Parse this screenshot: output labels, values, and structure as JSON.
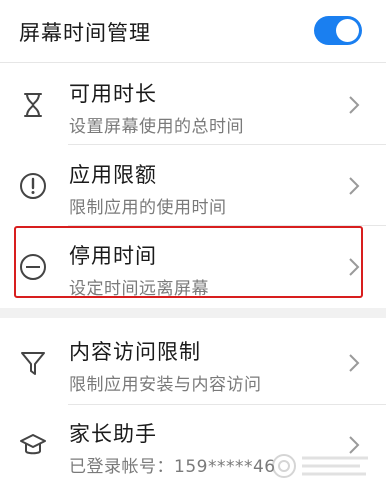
{
  "header": {
    "title": "屏幕时间管理",
    "toggle_on": true
  },
  "items": [
    {
      "title": "可用时长",
      "subtitle": "设置屏幕使用的总时间",
      "icon": "hourglass-icon"
    },
    {
      "title": "应用限额",
      "subtitle": "限制应用的使用时间",
      "icon": "exclamation-circle-icon"
    },
    {
      "title": "停用时间",
      "subtitle": "设定时间远离屏幕",
      "icon": "minus-circle-icon"
    },
    {
      "title": "内容访问限制",
      "subtitle": "限制应用安装与内容访问",
      "icon": "filter-icon"
    },
    {
      "title": "家长助手",
      "subtitle": "已登录帐号：159*****46",
      "icon": "graduation-cap-icon"
    }
  ],
  "colors": {
    "accent": "#1a7ff0",
    "highlight": "#d81e1e"
  }
}
